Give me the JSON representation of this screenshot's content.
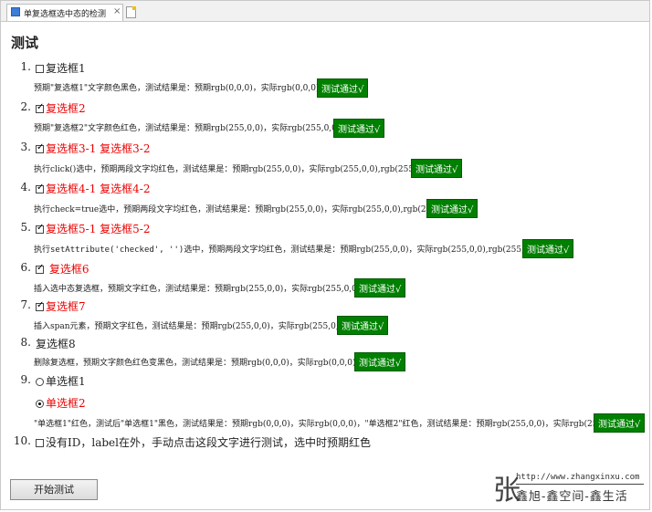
{
  "tab": {
    "title": "单复选框选中态的检测",
    "close": "×"
  },
  "heading": "测试",
  "items": [
    {
      "num": "1.",
      "labels": [
        "复选框1"
      ],
      "desc": "预期\"复选框1\"文字颜色黑色，测试结果是：预期rgb(0,0,0)，实际rgb(0,0,0)",
      "result": "测试通过√"
    },
    {
      "num": "2.",
      "labels": [
        "复选框2"
      ],
      "desc": "预期\"复选框2\"文字颜色红色，测试结果是：预期rgb(255,0,0)，实际rgb(255,0,0)",
      "result": "测试通过√"
    },
    {
      "num": "3.",
      "labels": [
        "复选框3-1",
        "复选框3-2"
      ],
      "desc": "执行click()选中，预期两段文字均红色，测试结果是：预期rgb(255,0,0)，实际rgb(255,0,0),rgb(255,0,0)",
      "result": "测试通过√"
    },
    {
      "num": "4.",
      "labels": [
        "复选框4-1",
        "复选框4-2"
      ],
      "desc": "执行check=true选中，预期两段文字均红色，测试结果是：预期rgb(255,0,0)，实际rgb(255,0,0),rgb(255,0,0)",
      "result": "测试通过√"
    },
    {
      "num": "5.",
      "labels": [
        "复选框5-1",
        "复选框5-2"
      ],
      "desc_pre": "执行",
      "desc_code": "setAttribute('checked', '')",
      "desc_post": "选中，预期两段文字均红色，测试结果是：预期rgb(255,0,0)，实际rgb(255,0,0),rgb(255,0,0)",
      "result": "测试通过√"
    },
    {
      "num": "6.",
      "labels": [
        "复选框6"
      ],
      "desc": "插入选中态复选框，预期文字红色，测试结果是：预期rgb(255,0,0)，实际rgb(255,0,0)",
      "result": "测试通过√"
    },
    {
      "num": "7.",
      "labels": [
        "复选框7"
      ],
      "desc": "插入span元素，预期文字红色，测试结果是：预期rgb(255,0,0)，实际rgb(255,0,0)",
      "result": "测试通过√"
    },
    {
      "num": "8.",
      "labels": [
        "复选框8"
      ],
      "desc": "删除复选框，预期文字颜色红色变黑色，测试结果是：预期rgb(0,0,0)，实际rgb(0,0,0)",
      "result": "测试通过√"
    },
    {
      "num": "9.",
      "labels": [
        "单选框1",
        "单选框2"
      ],
      "desc": "\"单选框1\"红色，测试后\"单选框1\"黑色，测试结果是：预期rgb(0,0,0)，实际rgb(0,0,0)，\"单选框2\"红色，测试结果是：预期rgb(255,0,0)，实际rgb(255,0,0)",
      "result": "测试通过√"
    },
    {
      "num": "10.",
      "labels": [
        "没有ID，label在外，手动点击这段文字进行测试，选中时预期红色"
      ]
    }
  ],
  "button": {
    "label": "开始测试"
  },
  "watermark": {
    "char": "张",
    "url": "http://www.zhangxinxu.com",
    "slogan": "鑫旭-鑫空间-鑫生活"
  },
  "colors": {
    "pass_bg": "#008000",
    "checked_text": "#ee0000"
  }
}
